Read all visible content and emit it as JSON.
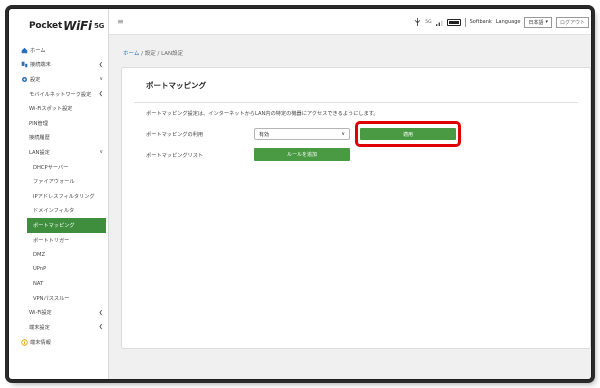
{
  "logo": {
    "prefix": "Pocket",
    "main": "WiFi",
    "suffix": "5G"
  },
  "topbar": {
    "menu_icon": "hamburger-icon",
    "network_label": "5G",
    "carrier": "Softbank",
    "language_label": "Language",
    "language_value": "日本語",
    "logout_label": "ログアウト"
  },
  "sidebar": {
    "items": [
      {
        "label": "ホーム",
        "icon": "home-icon"
      },
      {
        "label": "接続端末",
        "icon": "devices-icon"
      },
      {
        "label": "設定",
        "icon": "gear-icon"
      },
      {
        "label": "モバイルネットワーク設定"
      },
      {
        "label": "Wi-Fiスポット設定"
      },
      {
        "label": "PIN管理"
      },
      {
        "label": "接続履歴"
      },
      {
        "label": "LAN設定"
      },
      {
        "label": "DHCPサーバー"
      },
      {
        "label": "ファイアウォール"
      },
      {
        "label": "IPアドレスフィルタリング"
      },
      {
        "label": "ドメインフィルタ"
      },
      {
        "label": "ポートマッピング"
      },
      {
        "label": "ポートトリガー"
      },
      {
        "label": "DMZ"
      },
      {
        "label": "UPnP"
      },
      {
        "label": "NAT"
      },
      {
        "label": "VPNパススルー"
      },
      {
        "label": "Wi-Fi設定"
      },
      {
        "label": "端末設定"
      },
      {
        "label": "端末情報",
        "icon": "info-icon"
      }
    ]
  },
  "breadcrumb": {
    "home": "ホーム",
    "sep1": " / ",
    "settings": "設定",
    "sep2": " / ",
    "current": "LAN設定"
  },
  "main": {
    "title": "ポートマッピング",
    "description": "ポートマッピング設定は、インターネットからLAN内の特定の機器にアクセスできるようにします。",
    "usage_label": "ポートマッピングの利用",
    "usage_value": "有効",
    "apply_label": "適用",
    "list_label": "ポートマッピングリスト",
    "add_rule_label": "ルールを追加"
  },
  "colors": {
    "accent_green": "#4a9a43",
    "highlight_red": "#e00000",
    "link_blue": "#2a6ebd"
  }
}
